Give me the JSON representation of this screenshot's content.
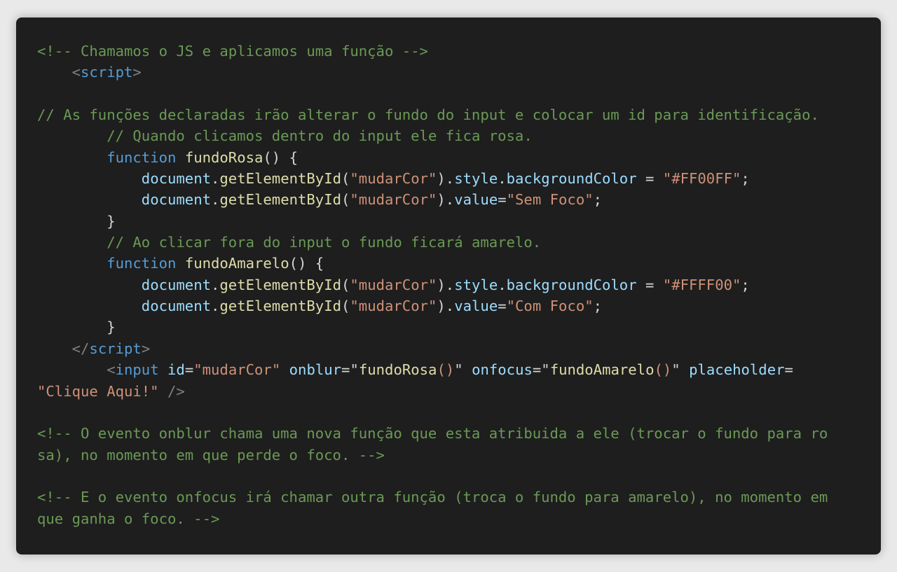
{
  "code_block": {
    "theme": {
      "background": "#1e1e1e",
      "page_background": "#e9e9e9",
      "comment": "#6a9955",
      "keyword": "#569cd6",
      "function_name": "#dcdcaa",
      "variable": "#9cdcfe",
      "string": "#ce9178",
      "bracket": "#808080",
      "default": "#d4d4d4"
    },
    "lines": [
      [
        {
          "t": "cmt",
          "v": "<!-- Chamamos o JS e aplicamos uma função -->"
        }
      ],
      [
        {
          "t": "pun",
          "v": "    "
        },
        {
          "t": "br",
          "v": "<"
        },
        {
          "t": "tag",
          "v": "script"
        },
        {
          "t": "br",
          "v": ">"
        }
      ],
      [],
      [
        {
          "t": "cmt",
          "v": "// As funções declaradas irão alterar o fundo do input e colocar um id para identificação."
        }
      ],
      [
        {
          "t": "pun",
          "v": "        "
        },
        {
          "t": "cmt",
          "v": "// Quando clicamos dentro do input ele fica rosa."
        }
      ],
      [
        {
          "t": "pun",
          "v": "        "
        },
        {
          "t": "kw",
          "v": "function"
        },
        {
          "t": "pun",
          "v": " "
        },
        {
          "t": "fn",
          "v": "fundoRosa"
        },
        {
          "t": "pun",
          "v": "() {"
        }
      ],
      [
        {
          "t": "pun",
          "v": "            "
        },
        {
          "t": "var",
          "v": "document"
        },
        {
          "t": "pun",
          "v": "."
        },
        {
          "t": "fn",
          "v": "getElementById"
        },
        {
          "t": "pun",
          "v": "("
        },
        {
          "t": "str",
          "v": "\"mudarCor\""
        },
        {
          "t": "pun",
          "v": ")."
        },
        {
          "t": "var",
          "v": "style"
        },
        {
          "t": "pun",
          "v": "."
        },
        {
          "t": "var",
          "v": "backgroundColor"
        },
        {
          "t": "pun",
          "v": " = "
        },
        {
          "t": "str",
          "v": "\"#FF00FF\""
        },
        {
          "t": "pun",
          "v": ";"
        }
      ],
      [
        {
          "t": "pun",
          "v": "            "
        },
        {
          "t": "var",
          "v": "document"
        },
        {
          "t": "pun",
          "v": "."
        },
        {
          "t": "fn",
          "v": "getElementById"
        },
        {
          "t": "pun",
          "v": "("
        },
        {
          "t": "str",
          "v": "\"mudarCor\""
        },
        {
          "t": "pun",
          "v": ")."
        },
        {
          "t": "var",
          "v": "value"
        },
        {
          "t": "pun",
          "v": "="
        },
        {
          "t": "str",
          "v": "\"Sem Foco\""
        },
        {
          "t": "pun",
          "v": ";"
        }
      ],
      [
        {
          "t": "pun",
          "v": "        }"
        }
      ],
      [
        {
          "t": "pun",
          "v": "        "
        },
        {
          "t": "cmt",
          "v": "// Ao clicar fora do input o fundo ficará amarelo."
        }
      ],
      [
        {
          "t": "pun",
          "v": "        "
        },
        {
          "t": "kw",
          "v": "function"
        },
        {
          "t": "pun",
          "v": " "
        },
        {
          "t": "fn",
          "v": "fundoAmarelo"
        },
        {
          "t": "pun",
          "v": "() {"
        }
      ],
      [
        {
          "t": "pun",
          "v": "            "
        },
        {
          "t": "var",
          "v": "document"
        },
        {
          "t": "pun",
          "v": "."
        },
        {
          "t": "fn",
          "v": "getElementById"
        },
        {
          "t": "pun",
          "v": "("
        },
        {
          "t": "str",
          "v": "\"mudarCor\""
        },
        {
          "t": "pun",
          "v": ")."
        },
        {
          "t": "var",
          "v": "style"
        },
        {
          "t": "pun",
          "v": "."
        },
        {
          "t": "var",
          "v": "backgroundColor"
        },
        {
          "t": "pun",
          "v": " = "
        },
        {
          "t": "str",
          "v": "\"#FFFF00\""
        },
        {
          "t": "pun",
          "v": ";"
        }
      ],
      [
        {
          "t": "pun",
          "v": "            "
        },
        {
          "t": "var",
          "v": "document"
        },
        {
          "t": "pun",
          "v": "."
        },
        {
          "t": "fn",
          "v": "getElementById"
        },
        {
          "t": "pun",
          "v": "("
        },
        {
          "t": "str",
          "v": "\"mudarCor\""
        },
        {
          "t": "pun",
          "v": ")."
        },
        {
          "t": "var",
          "v": "value"
        },
        {
          "t": "pun",
          "v": "="
        },
        {
          "t": "str",
          "v": "\"Com Foco\""
        },
        {
          "t": "pun",
          "v": ";"
        }
      ],
      [
        {
          "t": "pun",
          "v": "        }"
        }
      ],
      [
        {
          "t": "pun",
          "v": "    "
        },
        {
          "t": "br",
          "v": "</"
        },
        {
          "t": "tag",
          "v": "script"
        },
        {
          "t": "br",
          "v": ">"
        }
      ],
      [
        {
          "t": "pun",
          "v": "        "
        },
        {
          "t": "br",
          "v": "<"
        },
        {
          "t": "tag",
          "v": "input"
        },
        {
          "t": "pun",
          "v": " "
        },
        {
          "t": "var",
          "v": "id"
        },
        {
          "t": "pun",
          "v": "="
        },
        {
          "t": "str",
          "v": "\"mudarCor\""
        },
        {
          "t": "pun",
          "v": " "
        },
        {
          "t": "var",
          "v": "onblur"
        },
        {
          "t": "pun",
          "v": "=\""
        },
        {
          "t": "fn",
          "v": "fundoRosa"
        },
        {
          "t": "str",
          "v": "()"
        },
        {
          "t": "pun",
          "v": "\" "
        },
        {
          "t": "var",
          "v": "onfocus"
        },
        {
          "t": "pun",
          "v": "=\""
        },
        {
          "t": "fn",
          "v": "fundoAmarelo"
        },
        {
          "t": "str",
          "v": "()"
        },
        {
          "t": "pun",
          "v": "\" "
        },
        {
          "t": "var",
          "v": "placeholder"
        },
        {
          "t": "pun",
          "v": "="
        }
      ],
      [
        {
          "t": "str",
          "v": "\"Clique Aqui!\""
        },
        {
          "t": "pun",
          "v": " "
        },
        {
          "t": "br",
          "v": "/>"
        }
      ],
      [],
      [
        {
          "t": "cmt",
          "v": "<!-- O evento onblur chama uma nova função que esta atribuida a ele (trocar o fundo para ro"
        }
      ],
      [
        {
          "t": "cmt",
          "v": "sa), no momento em que perde o foco. -->"
        }
      ],
      [],
      [
        {
          "t": "cmt",
          "v": "<!-- E o evento onfocus irá chamar outra função (troca o fundo para amarelo), no momento em"
        }
      ],
      [
        {
          "t": "cmt",
          "v": "que ganha o foco. -->"
        }
      ]
    ]
  }
}
